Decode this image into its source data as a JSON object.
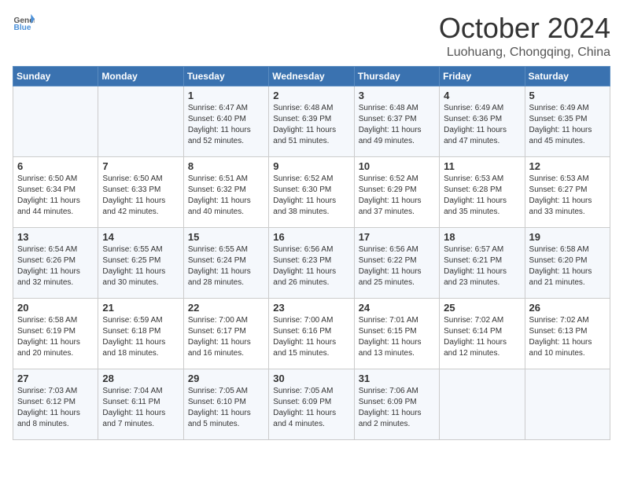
{
  "header": {
    "logo_general": "General",
    "logo_blue": "Blue",
    "title": "October 2024",
    "location": "Luohuang, Chongqing, China"
  },
  "columns": [
    "Sunday",
    "Monday",
    "Tuesday",
    "Wednesday",
    "Thursday",
    "Friday",
    "Saturday"
  ],
  "weeks": [
    [
      {
        "day": "",
        "info": ""
      },
      {
        "day": "",
        "info": ""
      },
      {
        "day": "1",
        "info": "Sunrise: 6:47 AM\nSunset: 6:40 PM\nDaylight: 11 hours and 52 minutes."
      },
      {
        "day": "2",
        "info": "Sunrise: 6:48 AM\nSunset: 6:39 PM\nDaylight: 11 hours and 51 minutes."
      },
      {
        "day": "3",
        "info": "Sunrise: 6:48 AM\nSunset: 6:37 PM\nDaylight: 11 hours and 49 minutes."
      },
      {
        "day": "4",
        "info": "Sunrise: 6:49 AM\nSunset: 6:36 PM\nDaylight: 11 hours and 47 minutes."
      },
      {
        "day": "5",
        "info": "Sunrise: 6:49 AM\nSunset: 6:35 PM\nDaylight: 11 hours and 45 minutes."
      }
    ],
    [
      {
        "day": "6",
        "info": "Sunrise: 6:50 AM\nSunset: 6:34 PM\nDaylight: 11 hours and 44 minutes."
      },
      {
        "day": "7",
        "info": "Sunrise: 6:50 AM\nSunset: 6:33 PM\nDaylight: 11 hours and 42 minutes."
      },
      {
        "day": "8",
        "info": "Sunrise: 6:51 AM\nSunset: 6:32 PM\nDaylight: 11 hours and 40 minutes."
      },
      {
        "day": "9",
        "info": "Sunrise: 6:52 AM\nSunset: 6:30 PM\nDaylight: 11 hours and 38 minutes."
      },
      {
        "day": "10",
        "info": "Sunrise: 6:52 AM\nSunset: 6:29 PM\nDaylight: 11 hours and 37 minutes."
      },
      {
        "day": "11",
        "info": "Sunrise: 6:53 AM\nSunset: 6:28 PM\nDaylight: 11 hours and 35 minutes."
      },
      {
        "day": "12",
        "info": "Sunrise: 6:53 AM\nSunset: 6:27 PM\nDaylight: 11 hours and 33 minutes."
      }
    ],
    [
      {
        "day": "13",
        "info": "Sunrise: 6:54 AM\nSunset: 6:26 PM\nDaylight: 11 hours and 32 minutes."
      },
      {
        "day": "14",
        "info": "Sunrise: 6:55 AM\nSunset: 6:25 PM\nDaylight: 11 hours and 30 minutes."
      },
      {
        "day": "15",
        "info": "Sunrise: 6:55 AM\nSunset: 6:24 PM\nDaylight: 11 hours and 28 minutes."
      },
      {
        "day": "16",
        "info": "Sunrise: 6:56 AM\nSunset: 6:23 PM\nDaylight: 11 hours and 26 minutes."
      },
      {
        "day": "17",
        "info": "Sunrise: 6:56 AM\nSunset: 6:22 PM\nDaylight: 11 hours and 25 minutes."
      },
      {
        "day": "18",
        "info": "Sunrise: 6:57 AM\nSunset: 6:21 PM\nDaylight: 11 hours and 23 minutes."
      },
      {
        "day": "19",
        "info": "Sunrise: 6:58 AM\nSunset: 6:20 PM\nDaylight: 11 hours and 21 minutes."
      }
    ],
    [
      {
        "day": "20",
        "info": "Sunrise: 6:58 AM\nSunset: 6:19 PM\nDaylight: 11 hours and 20 minutes."
      },
      {
        "day": "21",
        "info": "Sunrise: 6:59 AM\nSunset: 6:18 PM\nDaylight: 11 hours and 18 minutes."
      },
      {
        "day": "22",
        "info": "Sunrise: 7:00 AM\nSunset: 6:17 PM\nDaylight: 11 hours and 16 minutes."
      },
      {
        "day": "23",
        "info": "Sunrise: 7:00 AM\nSunset: 6:16 PM\nDaylight: 11 hours and 15 minutes."
      },
      {
        "day": "24",
        "info": "Sunrise: 7:01 AM\nSunset: 6:15 PM\nDaylight: 11 hours and 13 minutes."
      },
      {
        "day": "25",
        "info": "Sunrise: 7:02 AM\nSunset: 6:14 PM\nDaylight: 11 hours and 12 minutes."
      },
      {
        "day": "26",
        "info": "Sunrise: 7:02 AM\nSunset: 6:13 PM\nDaylight: 11 hours and 10 minutes."
      }
    ],
    [
      {
        "day": "27",
        "info": "Sunrise: 7:03 AM\nSunset: 6:12 PM\nDaylight: 11 hours and 8 minutes."
      },
      {
        "day": "28",
        "info": "Sunrise: 7:04 AM\nSunset: 6:11 PM\nDaylight: 11 hours and 7 minutes."
      },
      {
        "day": "29",
        "info": "Sunrise: 7:05 AM\nSunset: 6:10 PM\nDaylight: 11 hours and 5 minutes."
      },
      {
        "day": "30",
        "info": "Sunrise: 7:05 AM\nSunset: 6:09 PM\nDaylight: 11 hours and 4 minutes."
      },
      {
        "day": "31",
        "info": "Sunrise: 7:06 AM\nSunset: 6:09 PM\nDaylight: 11 hours and 2 minutes."
      },
      {
        "day": "",
        "info": ""
      },
      {
        "day": "",
        "info": ""
      }
    ]
  ]
}
